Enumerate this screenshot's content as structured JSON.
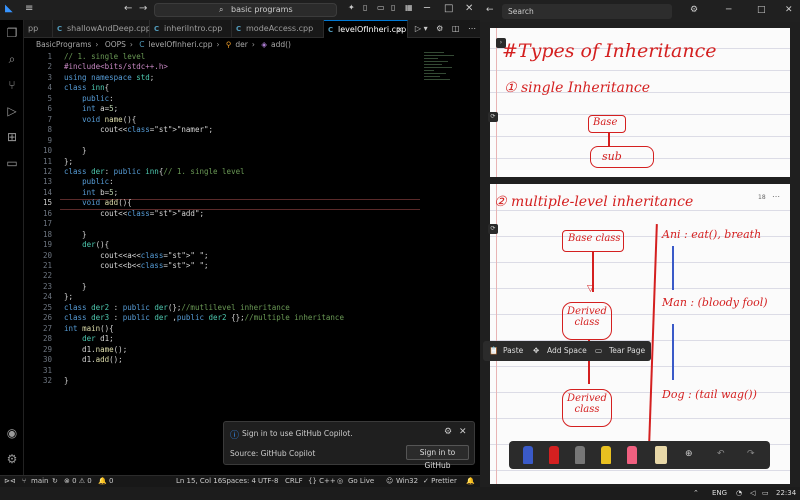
{
  "vscode": {
    "search_text": "basic programs",
    "tabs": [
      {
        "label": "pp",
        "active": false
      },
      {
        "label": "shallowAndDeep.cpp",
        "active": false
      },
      {
        "label": "inheriIntro.cpp",
        "active": false
      },
      {
        "label": "modeAccess.cpp",
        "active": false
      },
      {
        "label": "levelOfInheri.cpp",
        "active": true
      }
    ],
    "tab_close": "×",
    "breadcrumb": [
      "BasicPrograms",
      "OOPS",
      "levelOfInheri.cpp",
      "der",
      "add()"
    ],
    "code_lines": [
      {
        "n": "1",
        "text": "// 1. single level"
      },
      {
        "n": "2",
        "text": "#include<bits/stdc++.h>"
      },
      {
        "n": "3",
        "text": "using namespace std;"
      },
      {
        "n": "4",
        "text": "class inn{"
      },
      {
        "n": "5",
        "text": "    public:"
      },
      {
        "n": "6",
        "text": "    int a=5;"
      },
      {
        "n": "7",
        "text": "    void name(){"
      },
      {
        "n": "8",
        "text": "        cout<<\"namer\";"
      },
      {
        "n": "9",
        "text": ""
      },
      {
        "n": "10",
        "text": "    }"
      },
      {
        "n": "11",
        "text": "};"
      },
      {
        "n": "12",
        "text": "class der: public inn{// 1. single level"
      },
      {
        "n": "13",
        "text": "    public:"
      },
      {
        "n": "14",
        "text": "    int b=5;"
      },
      {
        "n": "15",
        "text": "    void add(){"
      },
      {
        "n": "16",
        "text": "        cout<<\"add\";"
      },
      {
        "n": "17",
        "text": ""
      },
      {
        "n": "18",
        "text": "    }"
      },
      {
        "n": "19",
        "text": "    der(){"
      },
      {
        "n": "20",
        "text": "        cout<<a<<\" \";"
      },
      {
        "n": "21",
        "text": "        cout<<b<<\" \";"
      },
      {
        "n": "22",
        "text": ""
      },
      {
        "n": "23",
        "text": "    }"
      },
      {
        "n": "24",
        "text": "};"
      },
      {
        "n": "25",
        "text": "class der2 : public der(};//mutlilevel inheritance"
      },
      {
        "n": "26",
        "text": "class der3 : public der ,public der2 {};//multiple inheritance"
      },
      {
        "n": "27",
        "text": "int main(){"
      },
      {
        "n": "28",
        "text": "    der d1;"
      },
      {
        "n": "29",
        "text": "    d1.name();"
      },
      {
        "n": "30",
        "text": "    d1.add();"
      },
      {
        "n": "31",
        "text": ""
      },
      {
        "n": "32",
        "text": "}"
      }
    ],
    "copilot": {
      "title": "Sign in to use GitHub Copilot.",
      "source": "Source: GitHub Copilot",
      "button": "Sign in to GitHub"
    },
    "status": {
      "branch": "main",
      "problems": "⊗ 0 ⚠ 0",
      "warnings": "🔔 0",
      "position": "Ln 15, Col 16",
      "spaces": "Spaces: 4",
      "encoding": "UTF-8",
      "eol": "CRLF",
      "language": "{} C++",
      "golive": "Go Live",
      "platform": "Win32",
      "prettier": "✓ Prettier"
    }
  },
  "onenote": {
    "search_placeholder": "Search",
    "page1": {
      "title": "#Types of Inheritance",
      "item": "① single Inheritance",
      "base": "Base",
      "sub": "sub"
    },
    "page2": {
      "page_num": "18",
      "heading": "② multiple-level inheritance",
      "boxes": [
        "Base class",
        "Derived class",
        "Derived class"
      ],
      "notes": [
        "Ani : eat(), breath",
        "Man : (bloody fool)",
        "Dog : (tail wag())"
      ]
    },
    "context_menu": {
      "paste": "Paste",
      "add_space": "Add Space",
      "tear_page": "Tear Page"
    },
    "pen_colors": [
      "#3a5ac8",
      "#d42020",
      "#777777",
      "#e8c020",
      "#f06080",
      "#e8d8a8"
    ]
  },
  "taskbar": {
    "lang": "ENG",
    "time": "22:34"
  }
}
